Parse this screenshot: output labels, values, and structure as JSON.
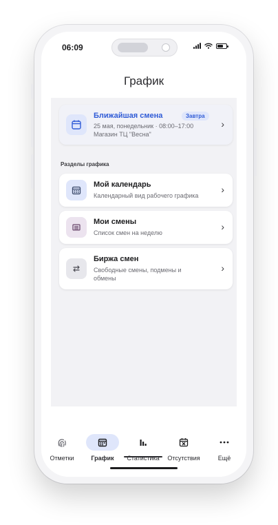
{
  "status_bar": {
    "time": "06:09"
  },
  "header": {
    "title": "График"
  },
  "next_shift": {
    "title": "Ближайшая смена",
    "badge": "Завтра",
    "details": "25 мая, понедельник · 08:00–17:00",
    "location": "Магазин ТЦ \"Весна\""
  },
  "section": {
    "label": "Разделы графика"
  },
  "menu": [
    {
      "title": "Мой календарь",
      "subtitle": "Календарный вид рабочего графика",
      "icon": "calendar-grid-icon"
    },
    {
      "title": "Мои смены",
      "subtitle": "Список смен на неделю",
      "icon": "list-icon"
    },
    {
      "title": "Биржа смен",
      "subtitle": "Свободные смены, подмены и обмены",
      "icon": "swap-arrows-icon"
    }
  ],
  "tabs": [
    {
      "label": "Отметки",
      "icon": "fingerprint-icon"
    },
    {
      "label": "График",
      "icon": "calendar-icon",
      "active": true
    },
    {
      "label": "Статистика",
      "icon": "bar-chart-icon"
    },
    {
      "label": "Отсутствия",
      "icon": "calendar-x-icon"
    },
    {
      "label": "Ещё",
      "icon": "more-icon"
    }
  ],
  "colors": {
    "accent": "#2f5bd6",
    "accent_bg": "#dfe6fb",
    "swap_bg": "#e7e7ec",
    "list_bg": "#ece3ef"
  }
}
